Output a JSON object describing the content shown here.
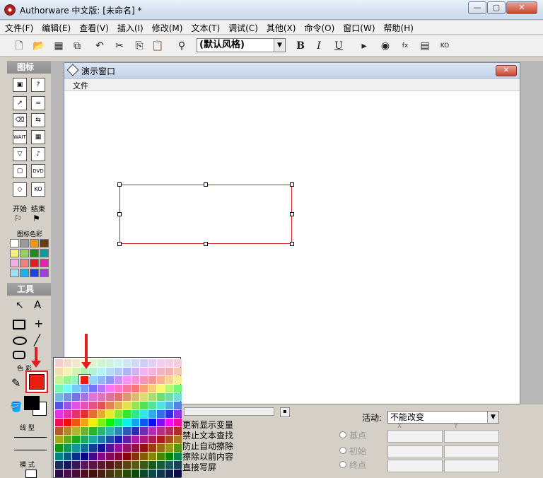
{
  "app": {
    "title": "Authorware 中文版: [未命名] *"
  },
  "window_controls": {
    "min": "—",
    "max": "▢",
    "close": "✕"
  },
  "menu": [
    "文件(F)",
    "编辑(E)",
    "查看(V)",
    "插入(I)",
    "修改(M)",
    "文本(T)",
    "调试(C)",
    "其他(X)",
    "命令(O)",
    "窗口(W)",
    "帮助(H)"
  ],
  "toolbar": {
    "style_value": "(默认风格)",
    "bold": "B",
    "italic": "I",
    "underline": "U"
  },
  "icons_panel": {
    "title": "图标",
    "start": "开始",
    "end": "结束",
    "icon_color": "图标色彩"
  },
  "tools_panel": {
    "title": "工具",
    "color_label": "色 彩",
    "line_label": "线 型",
    "mode_label": "模 式"
  },
  "presentation": {
    "title": "演示窗口",
    "menu_file": "文件"
  },
  "properties": {
    "options": [
      "更新显示变量",
      "禁止文本查找",
      "防止自动擦除",
      "擦除以前内容",
      "直接写屏"
    ],
    "activity_label": "活动:",
    "activity_value": "不能改变",
    "base": "基点",
    "initial": "初始",
    "end": "终点",
    "x": "X",
    "y": "Y"
  },
  "colors": {
    "accent": "#e02020",
    "selection": "#d02020"
  }
}
